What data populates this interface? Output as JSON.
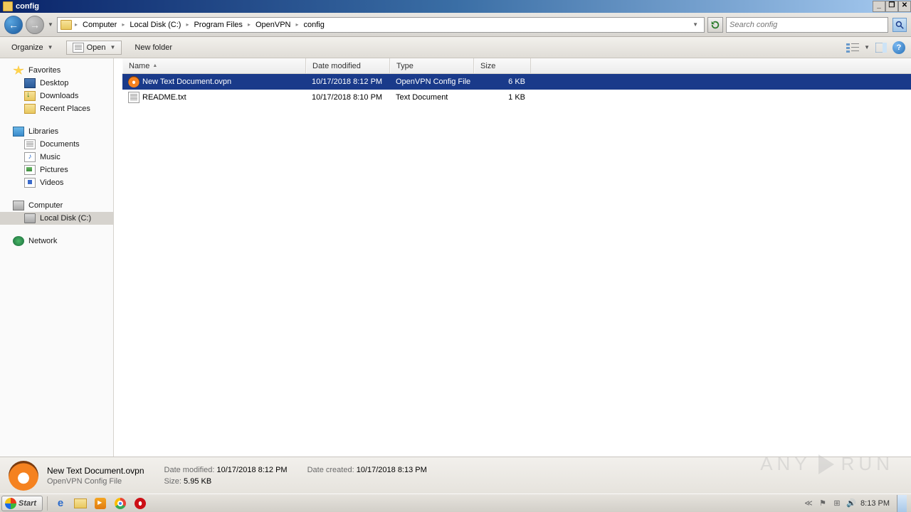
{
  "window": {
    "title": "config"
  },
  "breadcrumb": [
    "Computer",
    "Local Disk (C:)",
    "Program Files",
    "OpenVPN",
    "config"
  ],
  "search": {
    "placeholder": "Search config"
  },
  "toolbar": {
    "organize": "Organize",
    "open": "Open",
    "newfolder": "New folder"
  },
  "columns": {
    "name": "Name",
    "date": "Date modified",
    "type": "Type",
    "size": "Size"
  },
  "files": [
    {
      "name": "New Text Document.ovpn",
      "date": "10/17/2018 8:12 PM",
      "type": "OpenVPN Config File",
      "size": "6 KB",
      "icon": "ovpn",
      "selected": true
    },
    {
      "name": "README.txt",
      "date": "10/17/2018 8:10 PM",
      "type": "Text Document",
      "size": "1 KB",
      "icon": "txt",
      "selected": false
    }
  ],
  "nav": {
    "favorites": {
      "label": "Favorites",
      "items": [
        "Desktop",
        "Downloads",
        "Recent Places"
      ]
    },
    "libraries": {
      "label": "Libraries",
      "items": [
        "Documents",
        "Music",
        "Pictures",
        "Videos"
      ]
    },
    "computer": {
      "label": "Computer",
      "items": [
        "Local Disk (C:)"
      ]
    },
    "network": {
      "label": "Network"
    }
  },
  "details": {
    "name": "New Text Document.ovpn",
    "type": "OpenVPN Config File",
    "modified_label": "Date modified:",
    "modified": "10/17/2018 8:12 PM",
    "size_label": "Size:",
    "size": "5.95 KB",
    "created_label": "Date created:",
    "created": "10/17/2018 8:13 PM"
  },
  "taskbar": {
    "start": "Start",
    "clock": "8:13 PM"
  },
  "watermark": "ANY    RUN"
}
